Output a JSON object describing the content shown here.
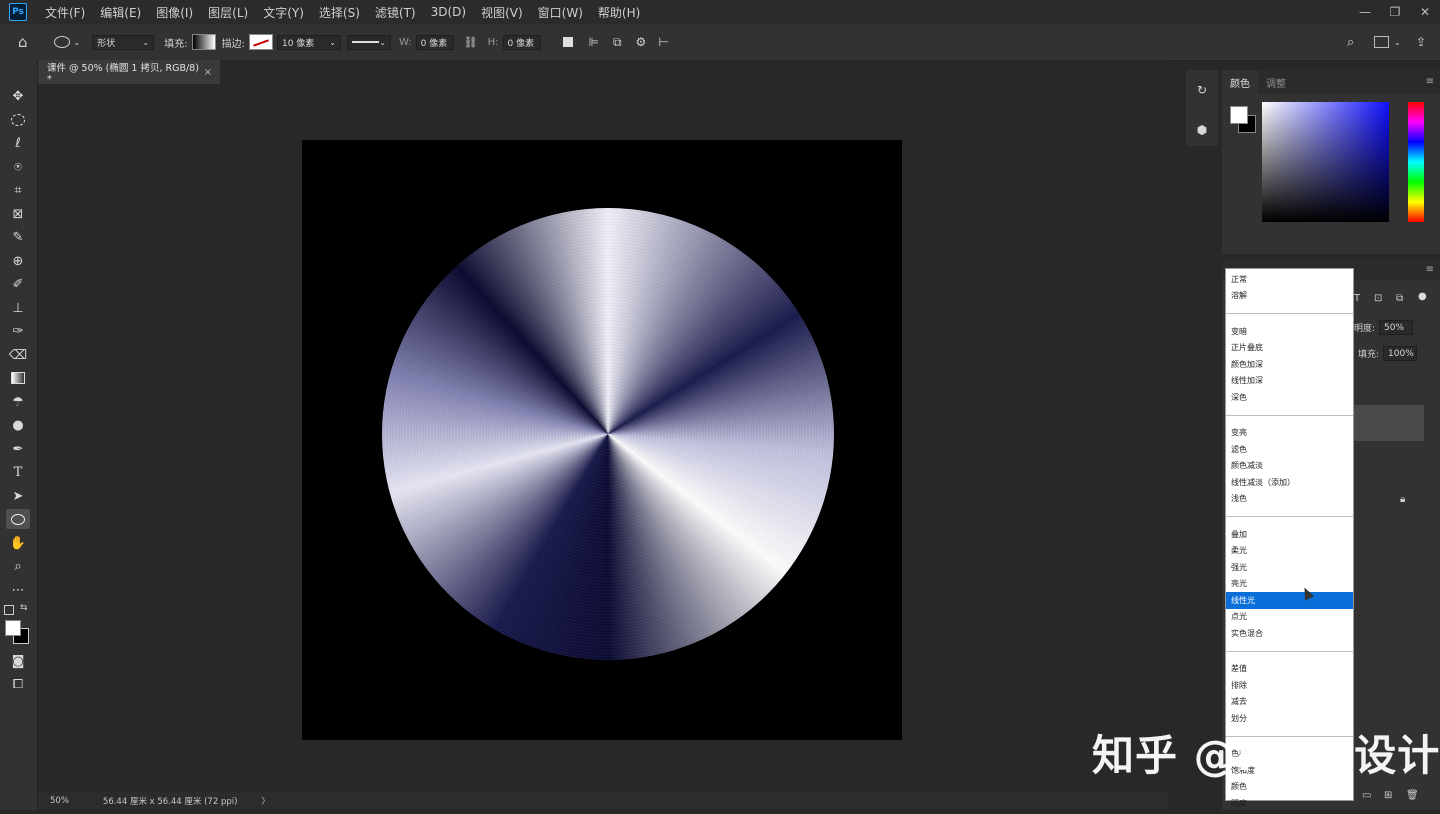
{
  "app": {
    "logo": "Ps"
  },
  "menu": [
    "文件(F)",
    "编辑(E)",
    "图像(I)",
    "图层(L)",
    "文字(Y)",
    "选择(S)",
    "滤镜(T)",
    "3D(D)",
    "视图(V)",
    "窗口(W)",
    "帮助(H)"
  ],
  "options": {
    "mode": "形状",
    "fill_label": "填充:",
    "stroke_label": "描边:",
    "stroke_width": "10 像素",
    "w_label": "W:",
    "w_value": "0 像素",
    "h_label": "H:",
    "h_value": "0 像素"
  },
  "document_tab": {
    "title": "课件 @ 50% (椭圆 1 拷贝, RGB/8) *",
    "close": "×"
  },
  "status": {
    "zoom": "50%",
    "doc_size": "56.44 厘米 x 56.44 厘米 (72 ppi)",
    "arrow": "〉"
  },
  "color_panel": {
    "tab_color": "颜色",
    "tab_adjust": "调整"
  },
  "layers_panel": {
    "opacity_label": "明度:",
    "opacity_value": "50%",
    "fill_label": "填充:",
    "fill_value": "100%"
  },
  "blend_modes": [
    [
      "正常",
      "溶解"
    ],
    [
      "变暗",
      "正片叠底",
      "颜色加深",
      "线性加深",
      "深色"
    ],
    [
      "变亮",
      "滤色",
      "颜色减淡",
      "线性减淡（添加）",
      "浅色"
    ],
    [
      "叠加",
      "柔光",
      "强光",
      "亮光",
      "线性光",
      "点光",
      "实色混合"
    ],
    [
      "差值",
      "排除",
      "减去",
      "划分"
    ],
    [
      "色相",
      "饱和度",
      "颜色",
      "明度"
    ]
  ],
  "selected_blend_mode": "线性光",
  "watermark": "知乎 @IFUN设计",
  "icons": [
    "home-icon",
    "ellipse-icon",
    "link-icon",
    "square-icon",
    "align-icon",
    "arrange-icon",
    "gear-icon",
    "search-icon",
    "frame-icon",
    "share-icon"
  ]
}
